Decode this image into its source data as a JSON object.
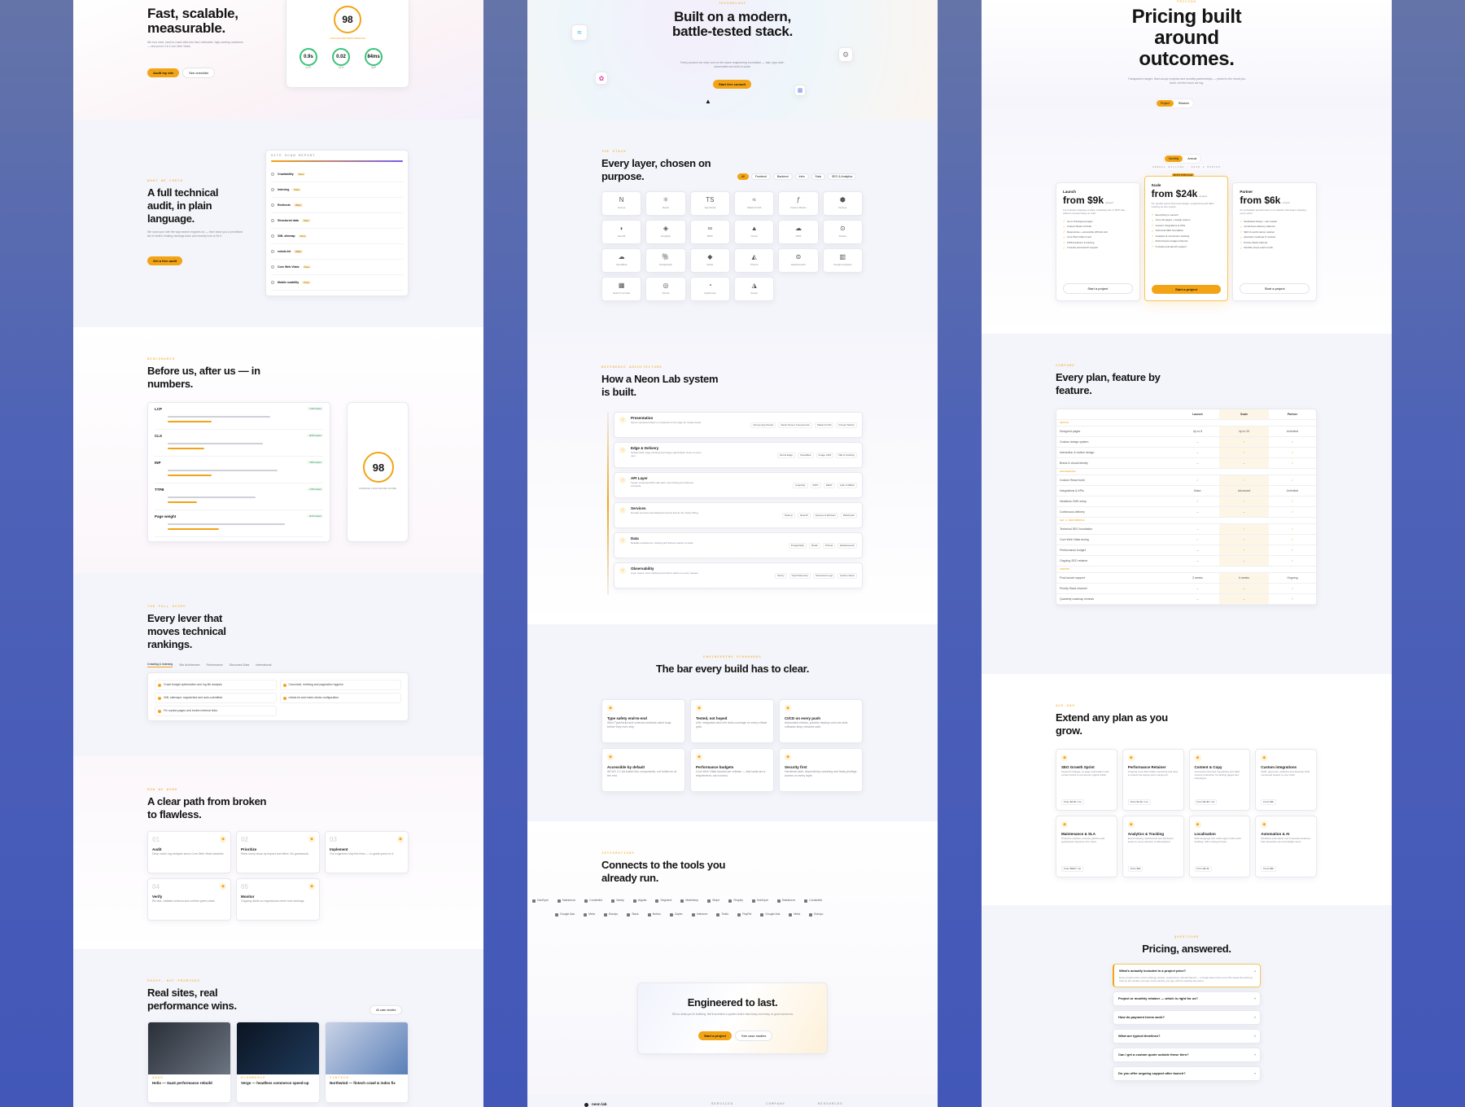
{
  "col1": {
    "hero": {
      "title": "Fast, scalable, measurable.",
      "body": "We turn slow, hard-to-crawl sites into fast, indexable, high-ranking machines — and prove it in Core Web Vitals.",
      "cta": "Audit my site",
      "cta2": "See checklist",
      "score": "98",
      "score_label": "LIGHTHOUSE PERFORMANCE",
      "vitals": [
        {
          "v": "0.9s",
          "l": "LCP"
        },
        {
          "v": "0.02",
          "l": "CLS"
        },
        {
          "v": "84ms",
          "l": "INP"
        }
      ]
    },
    "audit": {
      "eyebrow": "WHAT WE CHECK",
      "title": "A full technical audit, in plain language.",
      "body": "We scan your site the way search engines do — then hand you a prioritized list of what's holding rankings back and exactly how to fix it.",
      "cta": "Get a free audit",
      "report_title": "SITE SCAN REPORT",
      "items": [
        {
          "name": "Crawlability",
          "status": "Pass"
        },
        {
          "name": "Indexing",
          "status": "Pass"
        },
        {
          "name": "Redirects",
          "status": "Warn"
        },
        {
          "name": "Structured data",
          "status": "Pass"
        },
        {
          "name": "XML sitemap",
          "status": "Pass"
        },
        {
          "name": "robots.txt",
          "status": "Warn"
        },
        {
          "name": "Core Web Vitals",
          "status": "Pass"
        },
        {
          "name": "Mobile usability",
          "status": "Pass"
        }
      ]
    },
    "bench": {
      "eyebrow": "BENCHMARKS",
      "title": "Before us, after us — in numbers.",
      "metrics": [
        {
          "name": "LCP",
          "before": 0.7,
          "after": 0.3,
          "badge": "-74% better"
        },
        {
          "name": "CLS",
          "before": 0.65,
          "after": 0.25,
          "badge": "-83% better"
        },
        {
          "name": "INP",
          "before": 0.75,
          "after": 0.3,
          "badge": "-78% better"
        },
        {
          "name": "TTFB",
          "before": 0.6,
          "after": 0.2,
          "badge": "-74% better"
        },
        {
          "name": "Page weight",
          "before": 0.8,
          "after": 0.35,
          "badge": "-61% better"
        }
      ],
      "score": "98",
      "score_label": "AVERAGE LIGHTHOUSE SCORE"
    },
    "levers": {
      "eyebrow": "THE FULL SCOPE",
      "title": "Every lever that moves technical rankings.",
      "tabs": [
        "Crawling & Indexing",
        "Site Architecture",
        "Performance",
        "Structured Data",
        "International"
      ],
      "items": [
        "Crawl budget optimization and log file analysis",
        "Canonical, hreflang and pagination hygiene",
        "XML sitemaps, segmented and auto-submitted",
        "robots.txt and meta robots configuration",
        "Fix orphan pages and broken internal links"
      ]
    },
    "path": {
      "eyebrow": "HOW WE WORK",
      "title": "A clear path from broken to flawless.",
      "steps": [
        {
          "n": "01",
          "t": "Audit",
          "d": "Deep crawl, log analysis and a Core Web Vitals baseline."
        },
        {
          "n": "02",
          "t": "Prioritize",
          "d": "Rank every issue by impact and effort. No guesswork."
        },
        {
          "n": "03",
          "t": "Implement",
          "d": "Our engineers ship the fixes — or guide yours to it."
        },
        {
          "n": "04",
          "t": "Verify",
          "d": "Re-test, validate schema and confirm green vitals."
        },
        {
          "n": "05",
          "t": "Monitor",
          "d": "Ongoing alerts so regressions never hurt rankings."
        }
      ]
    },
    "cases": {
      "eyebrow": "PROOF, NOT PROMISES",
      "title": "Real sites, real performance wins.",
      "link": "All case studies",
      "items": [
        {
          "t": "Helio — SaaS performance rebuild",
          "tag": "SAAS"
        },
        {
          "t": "Verge — headless commerce speed-up",
          "tag": "ECOMMERCE"
        },
        {
          "t": "Northwind — fintech crawl & index fix",
          "tag": "FINTECH"
        }
      ]
    }
  },
  "col2": {
    "hero": {
      "eyebrow": "TECHNOLOGY",
      "title": "Built on a modern, battle-tested stack.",
      "body": "Every product we ship runs on the same engineering foundation — fast, type-safe, observable and built to scale.",
      "cta": "Start free consult"
    },
    "stack": {
      "eyebrow": "THE STACK",
      "title": "Every layer, chosen on purpose.",
      "filters": [
        "All",
        "Frontend",
        "Backend",
        "Infra",
        "Data",
        "SEO & Analytics"
      ],
      "tools": [
        "Next.js",
        "React",
        "TypeScript",
        "Tailwind CSS",
        "Framer Motion",
        "Node.js",
        "NestJS",
        "GraphQL",
        "tRPC",
        "Vercel",
        "AWS",
        "Docker",
        "Cloudflare",
        "PostgreSQL",
        "Redis",
        "Prisma",
        "Elasticsearch",
        "Google Analytics",
        "Search Console",
        "Ahrefs",
        "Lighthouse",
        "Sentry"
      ]
    },
    "arch": {
      "eyebrow": "REFERENCE ARCHITECTURE",
      "title": "How a Neon Lab system is built.",
      "layers": [
        {
          "t": "Presentation",
          "d": "Server-rendered React on streamed to the edge for instant loads.",
          "tags": [
            "Next.js App Router",
            "React Server Components",
            "Tailwind CSS",
            "Framer Motion"
          ]
        },
        {
          "t": "Edge & Delivery",
          "d": "Global CDN, edge caching and image optimization close to every user.",
          "tags": [
            "Vercel Edge",
            "Cloudflare",
            "Image CDN",
            "ISR & Caching"
          ]
        },
        {
          "t": "API Layer",
          "d": "Typed, versioned APIs with auth, rate limiting and schema contracts.",
          "tags": [
            "GraphQL",
            "tRPC",
            "REST",
            "Auth & RBAC"
          ]
        },
        {
          "t": "Services",
          "d": "Domain services and background jobs that do the heavy lifting.",
          "tags": [
            "Node.js",
            "NestJS",
            "Queues & Workers",
            "Webhooks"
          ]
        },
        {
          "t": "Data",
          "d": "Reliable persistence, caching and full-text search at scale.",
          "tags": [
            "PostgreSQL",
            "Redis",
            "Prisma",
            "Elasticsearch"
          ]
        },
        {
          "t": "Observability",
          "d": "Logs, traces, error tracking and uptime alerts on every release.",
          "tags": [
            "Sentry",
            "OpenTelemetry",
            "Structured Logs",
            "Uptime Alerts"
          ]
        }
      ]
    },
    "standards": {
      "eyebrow": "ENGINEERING STANDARDS",
      "title": "The bar every build has to clear.",
      "items": [
        {
          "t": "Type safety end-to-end",
          "d": "Strict TypeScript and schema contracts catch bugs before they ever ship."
        },
        {
          "t": "Tested, not hoped",
          "d": "Unit, integration and e2e tests coverage on every critical path."
        },
        {
          "t": "CI/CD on every push",
          "d": "Automated checks, preview deploys and one-click rollbacks keep releases safe."
        },
        {
          "t": "Accessible by default",
          "d": "WCAG 2.1 AA baked into components, not bolted on at the end."
        },
        {
          "t": "Performance budgets",
          "d": "Core Web Vitals tracked per release — fast loads are a requirement, not a bonus."
        },
        {
          "t": "Security first",
          "d": "Hardened auth, dependency scanning and least-privilege access on every layer."
        }
      ]
    },
    "integrations": {
      "eyebrow": "INTEGRATIONS",
      "title": "Connects to the tools you already run.",
      "row1": [
        "HubSpot",
        "Salesforce",
        "Contentful",
        "Sanity",
        "Algolia",
        "Segment",
        "Mailchimp",
        "Stripe",
        "Shopify",
        "HubSpot",
        "Salesforce",
        "Contentful"
      ],
      "row2": [
        "Google Ads",
        "Meta",
        "Klaviyo",
        "Slack",
        "Notion",
        "Zapier",
        "Intercom",
        "Twilio",
        "PayPal",
        "Google Ads",
        "Meta",
        "Klaviyo"
      ]
    },
    "cta": {
      "title": "Engineered to last.",
      "body": "Tell us what you're building. We'll architect a system that's fast today and easy to grow tomorrow.",
      "b1": "Start a project",
      "b2": "See case studies"
    },
    "footer": {
      "brand": "neon lab",
      "cols": [
        "SERVICES",
        "COMPANY",
        "RESOURCES"
      ]
    }
  },
  "col3": {
    "hero": {
      "eyebrow": "PRICING",
      "title": "Pricing built around outcomes.",
      "body": "Transparent ranges, fixed-scope projects and monthly partnerships — priced to the result you need, not the hours we log.",
      "toggle": [
        "Project",
        "Retainer"
      ]
    },
    "plans": {
      "billing": [
        "Monthly",
        "Annual"
      ],
      "billing_note": "ANNUAL BILLING · SAVE 2 MONTHS",
      "popular": "MOST POPULAR",
      "items": [
        {
          "name": "Launch",
          "price": "from $9k",
          "unit": "/project",
          "desc": "For founders shipping a sharp marketing site or MVP fast, without compromising on craft.",
          "features": [
            "Up to 8 designed pages",
            "Custom React UI build",
            "Responsive + accessible (WCAG AA)",
            "Core Web Vitals tuned",
            "CMS handover & training",
            "2 weeks post-launch support"
          ],
          "cta": "Start a project"
        },
        {
          "name": "Scale",
          "price": "from $24k",
          "unit": "/project",
          "desc": "For growth teams that need design, engineering and SEO working as one system.",
          "features": [
            "Everything in Launch",
            "Up to 20 pages + design system",
            "Custom integrations & APIs",
            "Technical SEO foundation",
            "Analytics & conversion tracking",
            "Performance budget enforced",
            "6 weeks post-launch support"
          ],
          "cta": "Start a project"
        },
        {
          "name": "Partner",
          "price": "from $6k",
          "unit": "/month",
          "desc": "An embedded product team on a retainer that keeps shipping every sprint.",
          "features": [
            "Dedicated design + dev squad",
            "Continuous delivery cadence",
            "SEO & performance retainer",
            "Quarterly roadmap & reviews",
            "Priority Slack channel",
            "Flexible scope each month"
          ],
          "cta": "Start a project"
        }
      ]
    },
    "compare": {
      "eyebrow": "COMPARE",
      "title": "Every plan, feature by feature.",
      "cols": [
        "Launch",
        "Scale",
        "Partner"
      ],
      "groups": [
        {
          "g": "DESIGN",
          "rows": [
            [
              "Designed pages",
              "Up to 8",
              "Up to 20",
              "Unlimited"
            ],
            [
              "Custom design system",
              "–",
              "✓",
              "✓"
            ],
            [
              "Interaction & motion design",
              "–",
              "✓",
              "✓"
            ],
            [
              "Brand & visual identity",
              "–",
              "–",
              "✓"
            ]
          ]
        },
        {
          "g": "ENGINEERING",
          "rows": [
            [
              "Custom React build",
              "✓",
              "✓",
              "✓"
            ],
            [
              "Integrations & APIs",
              "Basic",
              "Advanced",
              "Unlimited"
            ],
            [
              "Headless CMS setup",
              "✓",
              "✓",
              "✓"
            ],
            [
              "Continuous delivery",
              "–",
              "–",
              "✓"
            ]
          ]
        },
        {
          "g": "SEO & PERFORMANCE",
          "rows": [
            [
              "Technical SEO foundation",
              "–",
              "✓",
              "✓"
            ],
            [
              "Core Web Vitals tuning",
              "✓",
              "✓",
              "✓"
            ],
            [
              "Performance budget",
              "–",
              "✓",
              "✓"
            ],
            [
              "Ongoing SEO retainer",
              "–",
              "–",
              "✓"
            ]
          ]
        },
        {
          "g": "SUPPORT",
          "rows": [
            [
              "Post-launch support",
              "2 weeks",
              "6 weeks",
              "Ongoing"
            ],
            [
              "Priority Slack channel",
              "–",
              "–",
              "✓"
            ],
            [
              "Quarterly roadmap reviews",
              "–",
              "–",
              "✓"
            ]
          ]
        }
      ]
    },
    "addons": {
      "eyebrow": "ADD-ONS",
      "title": "Extend any plan as you grow.",
      "items": [
        {
          "t": "SEO Growth Sprint",
          "d": "Keyword strategy, on-page optimization and content briefs to compound organic traffic.",
          "p": "From $2.5k / mo"
        },
        {
          "t": "Performance Retainer",
          "d": "Ongoing Core Web Vitals monitoring and fixes to protect the speed you're paying for.",
          "p": "From $1.2k / mo"
        },
        {
          "t": "Content & Copy",
          "d": "Conversion-focused copywriting and SEO content production for landing pages and campaigns.",
          "p": "From $1.8k / mo"
        },
        {
          "t": "Custom integrations",
          "d": "CRM, payments, analytics and bespoke APIs connected cleanly to your build.",
          "p": "From $3k"
        },
        {
          "t": "Maintenance & SLA",
          "d": "Proactive updates, security patches and guaranteed response time SLAs.",
          "p": "From $900 / mo"
        },
        {
          "t": "Analytics & Tracking",
          "d": "Event tracking, dashboards and attribution setup so every decision is data-backed.",
          "p": "From $2k"
        },
        {
          "t": "Localisation",
          "d": "Multi-language and multi-region rollout with hreflang, i18n routing and QA.",
          "p": "From $2.4k"
        },
        {
          "t": "Automation & AI",
          "d": "Workflow automation and AI assisted features that streamline ops and delight users.",
          "p": "From $4k"
        }
      ]
    },
    "faq": {
      "eyebrow": "QUESTIONS",
      "title": "Pricing, answered.",
      "items": [
        {
          "q": "What's actually included in a project price?",
          "a": "Every project price covers strategy, design, engineering, QA and launch — a single team end to end. We scope the work up front so the number you see is the number you pay, with no surprise line items."
        },
        {
          "q": "Project or monthly retainer — which is right for us?"
        },
        {
          "q": "How do payment terms work?"
        },
        {
          "q": "What are typical timelines?"
        },
        {
          "q": "Can I get a custom quote outside these tiers?"
        },
        {
          "q": "Do you offer ongoing support after launch?"
        }
      ]
    }
  },
  "colors": {
    "accent": "#f2a416",
    "green": "#3cc27a",
    "backdrop": "#4e62b7"
  }
}
